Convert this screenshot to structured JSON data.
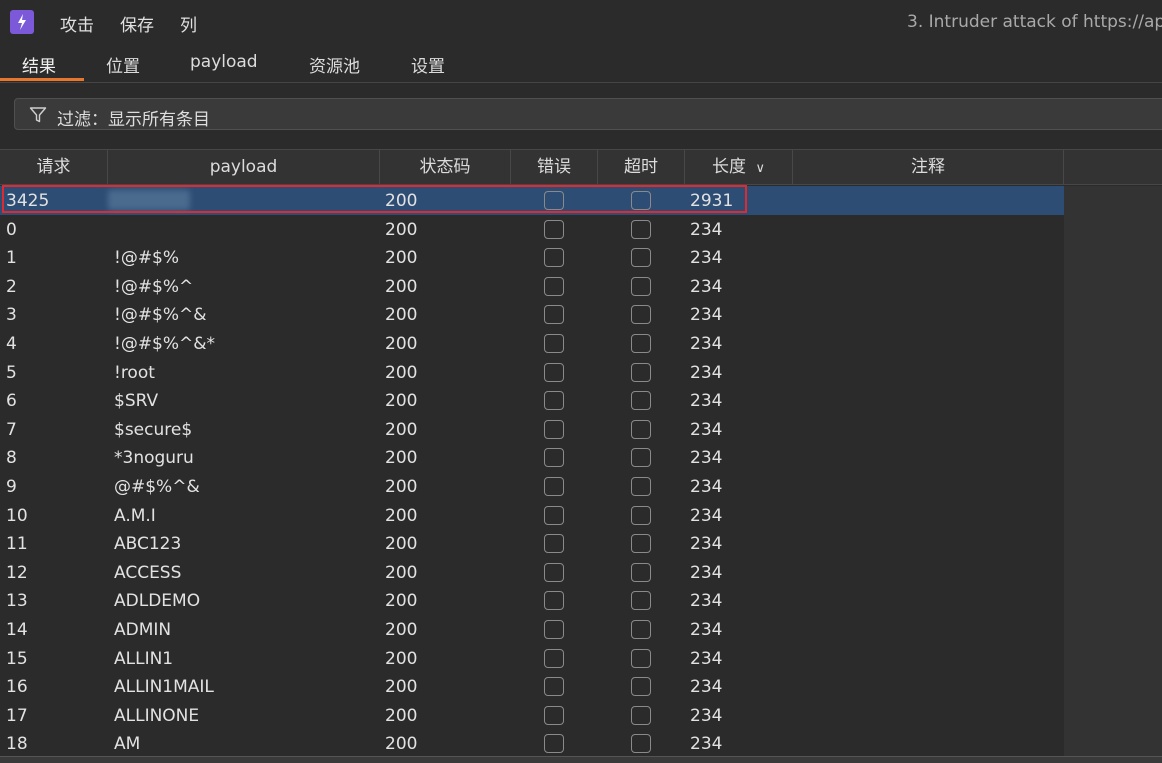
{
  "menu": {
    "items": [
      "攻击",
      "保存",
      "列"
    ]
  },
  "window_title": "3. Intruder attack of https://ap",
  "tabs": [
    "结果",
    "位置",
    "payload",
    "资源池",
    "设置"
  ],
  "filter": {
    "label": "过滤：显示所有条目"
  },
  "table": {
    "columns": [
      "请求",
      "payload",
      "状态码",
      "错误",
      "超时",
      "长度",
      "注释"
    ],
    "sort_indicator": "∨",
    "rows": [
      {
        "request": "3425",
        "payload": "",
        "status": "200",
        "length": "2931",
        "selected": true
      },
      {
        "request": "0",
        "payload": "",
        "status": "200",
        "length": "234"
      },
      {
        "request": "1",
        "payload": "!@#$%",
        "status": "200",
        "length": "234"
      },
      {
        "request": "2",
        "payload": "!@#$%^",
        "status": "200",
        "length": "234"
      },
      {
        "request": "3",
        "payload": "!@#$%^&",
        "status": "200",
        "length": "234"
      },
      {
        "request": "4",
        "payload": "!@#$%^&*",
        "status": "200",
        "length": "234"
      },
      {
        "request": "5",
        "payload": "!root",
        "status": "200",
        "length": "234"
      },
      {
        "request": "6",
        "payload": "$SRV",
        "status": "200",
        "length": "234"
      },
      {
        "request": "7",
        "payload": "$secure$",
        "status": "200",
        "length": "234"
      },
      {
        "request": "8",
        "payload": "*3noguru",
        "status": "200",
        "length": "234"
      },
      {
        "request": "9",
        "payload": "@#$%^&",
        "status": "200",
        "length": "234"
      },
      {
        "request": "10",
        "payload": "A.M.I",
        "status": "200",
        "length": "234"
      },
      {
        "request": "11",
        "payload": "ABC123",
        "status": "200",
        "length": "234"
      },
      {
        "request": "12",
        "payload": "ACCESS",
        "status": "200",
        "length": "234"
      },
      {
        "request": "13",
        "payload": "ADLDEMO",
        "status": "200",
        "length": "234"
      },
      {
        "request": "14",
        "payload": "ADMIN",
        "status": "200",
        "length": "234"
      },
      {
        "request": "15",
        "payload": "ALLIN1",
        "status": "200",
        "length": "234"
      },
      {
        "request": "16",
        "payload": "ALLIN1MAIL",
        "status": "200",
        "length": "234"
      },
      {
        "request": "17",
        "payload": "ALLINONE",
        "status": "200",
        "length": "234"
      },
      {
        "request": "18",
        "payload": "AM",
        "status": "200",
        "length": "234"
      }
    ]
  },
  "colors": {
    "accent": "#e8762c",
    "selected_row": "#2e4d74",
    "highlight": "#e02a32",
    "logo": "#7b59d9"
  },
  "icons": {
    "logo": "burp-logo-icon",
    "filter": "filter-icon",
    "sort": "chevron-down-icon"
  }
}
